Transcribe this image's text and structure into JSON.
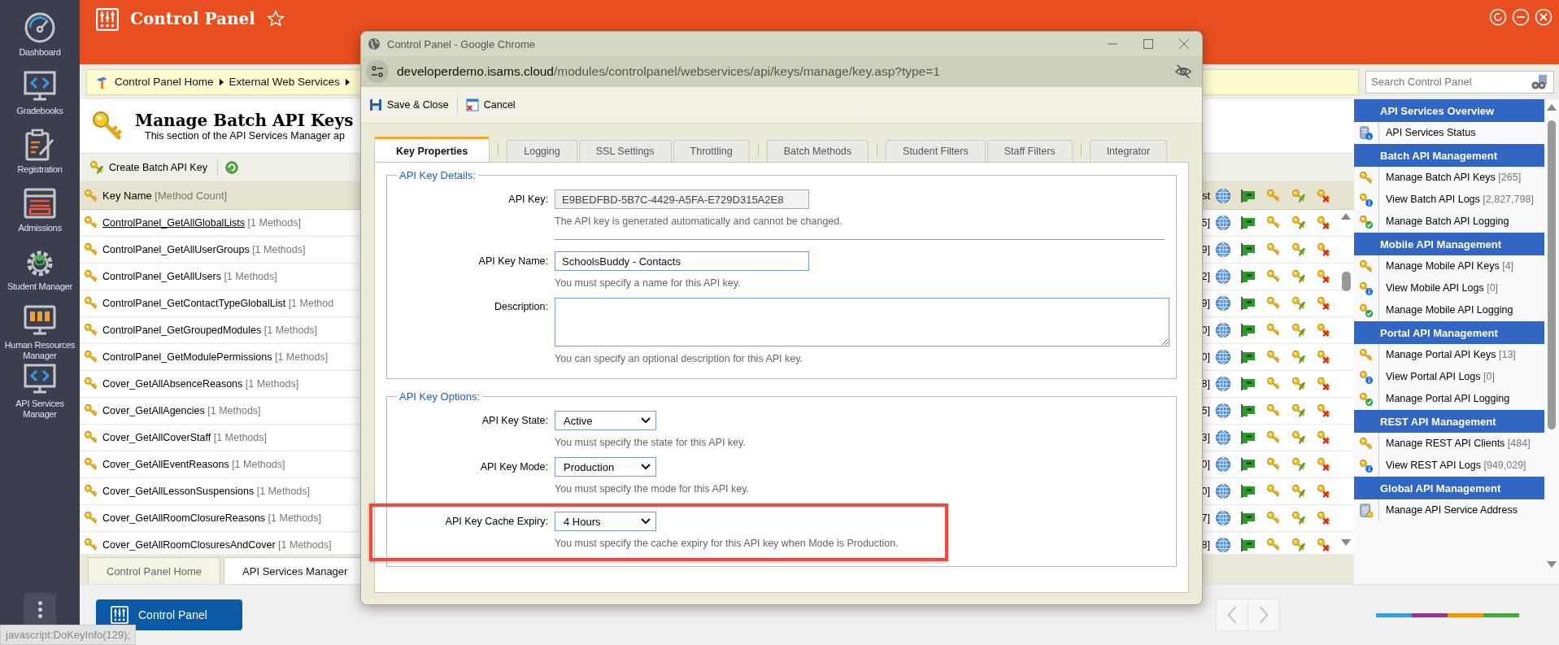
{
  "nav": {
    "items": [
      {
        "label": "Dashboard"
      },
      {
        "label": "Gradebooks"
      },
      {
        "label": "Registration"
      },
      {
        "label": "Admissions"
      },
      {
        "label": "Student Manager"
      },
      {
        "label": "Human Resources Manager"
      },
      {
        "label": "API Services Manager"
      }
    ]
  },
  "header": {
    "title": "Control Panel"
  },
  "breadcrumb": [
    "Control Panel Home",
    "External Web Services"
  ],
  "search": {
    "placeholder": "Search Control Panel"
  },
  "page": {
    "title": "Manage Batch API Keys",
    "subtitle": "This section of the API Services Manager ap"
  },
  "toolbar": {
    "create": "Create Batch API Key"
  },
  "table": {
    "columns": {
      "name": "Key Name",
      "count": "[Method Count]",
      "column_3": "st"
    },
    "rows": [
      {
        "name": "ControlPanel_GetAllGlobalLists",
        "count": "[1 Methods]",
        "column_3": "5]",
        "selected": true
      },
      {
        "name": "ControlPanel_GetAllUserGroups",
        "count": "[1 Methods]",
        "column_3": "9]",
        "selected": false
      },
      {
        "name": "ControlPanel_GetAllUsers",
        "count": "[1 Methods]",
        "column_3": "2]",
        "selected": false
      },
      {
        "name": "ControlPanel_GetContactTypeGlobalList",
        "count": "[1 Method",
        "column_3": "9]",
        "selected": false
      },
      {
        "name": "ControlPanel_GetGroupedModules",
        "count": "[1 Methods]",
        "column_3": "0]",
        "selected": false
      },
      {
        "name": "ControlPanel_GetModulePermissions",
        "count": "[1 Methods]",
        "column_3": "0]",
        "selected": false
      },
      {
        "name": "Cover_GetAllAbsenceReasons",
        "count": "[1 Methods]",
        "column_3": "8]",
        "selected": false
      },
      {
        "name": "Cover_GetAllAgencies",
        "count": "[1 Methods]",
        "column_3": "5]",
        "selected": false
      },
      {
        "name": "Cover_GetAllCoverStaff",
        "count": "[1 Methods]",
        "column_3": "3]",
        "selected": false
      },
      {
        "name": "Cover_GetAllEventReasons",
        "count": "[1 Methods]",
        "column_3": "0]",
        "selected": false
      },
      {
        "name": "Cover_GetAllLessonSuspensions",
        "count": "[1 Methods]",
        "column_3": "0]",
        "selected": false
      },
      {
        "name": "Cover_GetAllRoomClosureReasons",
        "count": "[1 Methods]",
        "column_3": "7]",
        "selected": false
      },
      {
        "name": "Cover_GetAllRoomClosuresAndCover",
        "count": "[1 Methods]",
        "column_3": "8]",
        "selected": false
      }
    ]
  },
  "bottom_tabs": [
    {
      "label": "Control Panel Home",
      "selected": false
    },
    {
      "label": "API Services Manager",
      "selected": true
    }
  ],
  "right_panel": {
    "sections": [
      {
        "title": "API Services Overview",
        "items": [
          {
            "kind": "status",
            "label": "API Services Status"
          }
        ]
      },
      {
        "title": "Batch API Management",
        "items": [
          {
            "kind": "keys",
            "label": "Manage Batch API Keys",
            "count": "[265]"
          },
          {
            "kind": "logs",
            "label": "View Batch API Logs",
            "count": "[2,827,798]"
          },
          {
            "kind": "logging",
            "label": "Manage Batch API Logging"
          }
        ]
      },
      {
        "title": "Mobile API Management",
        "items": [
          {
            "kind": "keys",
            "label": "Manage Mobile API Keys",
            "count": "[4]"
          },
          {
            "kind": "logs",
            "label": "View Mobile API Logs",
            "count": "[0]"
          },
          {
            "kind": "logging",
            "label": "Manage Mobile API Logging"
          }
        ]
      },
      {
        "title": "Portal API Management",
        "items": [
          {
            "kind": "keys",
            "label": "Manage Portal API Keys",
            "count": "[13]"
          },
          {
            "kind": "logs",
            "label": "View Portal API Logs",
            "count": "[0]"
          },
          {
            "kind": "logging",
            "label": "Manage Portal API Logging"
          }
        ]
      },
      {
        "title": "REST API Management",
        "items": [
          {
            "kind": "keys",
            "label": "Manage REST API Clients",
            "count": "[484]"
          },
          {
            "kind": "logs",
            "label": "View REST API Logs",
            "count": "[949,029]"
          }
        ]
      },
      {
        "title": "Global API Management",
        "items": [
          {
            "kind": "address",
            "label": "Manage API Service Address"
          }
        ]
      }
    ]
  },
  "footer": {
    "button": "Control Panel"
  },
  "status_bar": "javascript:DoKeyInfo(129);",
  "dialog": {
    "window_title": "Control Panel - Google Chrome",
    "url_host": "developerdemo.isams.cloud",
    "url_path": "/modules/controlpanel/webservices/api/keys/manage/key.asp?type=1",
    "toolbar": [
      {
        "kind": "save",
        "label": "Save & Close"
      },
      {
        "kind": "cancel",
        "label": "Cancel"
      }
    ],
    "tabs": [
      {
        "label": "Key Properties",
        "selected": true,
        "separator_before": false
      },
      {
        "label": "Logging",
        "selected": false,
        "separator_before": true
      },
      {
        "label": "SSL Settings",
        "selected": false,
        "separator_before": false
      },
      {
        "label": "Throttling",
        "selected": false,
        "separator_before": false
      },
      {
        "label": "Batch Methods",
        "selected": false,
        "separator_before": true
      },
      {
        "label": "Student Filters",
        "selected": false,
        "separator_before": true
      },
      {
        "label": "Staff Filters",
        "selected": false,
        "separator_before": false
      },
      {
        "label": "Integrator",
        "selected": false,
        "separator_before": true
      }
    ],
    "details": {
      "legend": "API Key Details:",
      "fields": [
        {
          "kind": "readonly",
          "label": "API Key:",
          "value": "E9BEDFBD-5B7C-4429-A5FA-E729D315A2E8",
          "hint": "The API key is generated automatically and cannot be changed."
        },
        {
          "kind": "text",
          "label": "API Key Name:",
          "value": "SchoolsBuddy - Contacts",
          "hint": "You must specify a name for this API key."
        },
        {
          "kind": "textarea",
          "label": "Description:",
          "hint": "You can specify an optional description for this API key."
        }
      ]
    },
    "options": {
      "legend": "API Key Options:",
      "fields": [
        {
          "label": "API Key State:",
          "value": "Active",
          "hint": "You must specify the state for this API key.",
          "highlighted": false
        },
        {
          "label": "API Key Mode:",
          "value": "Production",
          "hint": "You must specify the mode for this API key.",
          "highlighted": false
        },
        {
          "label": "API Key Cache Expiry:",
          "value": "4 Hours",
          "hint": "You must specify the cache expiry for this API key when Mode is Production.",
          "highlighted": true
        }
      ]
    }
  }
}
